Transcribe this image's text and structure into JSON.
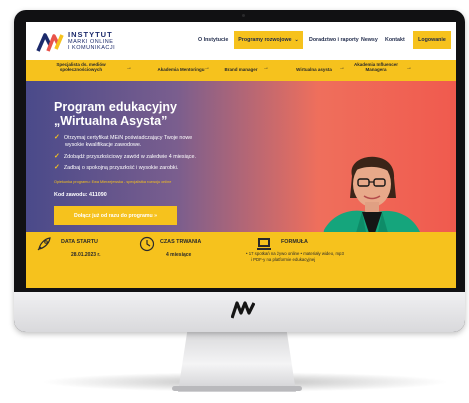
{
  "header": {
    "logo": {
      "line1": "INSTYTUT",
      "line2": "MARKI ONLINE",
      "line3": "I KOMUNIKACJI"
    },
    "nav": {
      "about": "O Instytucie",
      "development": "Programy rozwojowe",
      "consulting": "Doradztwo i raporty",
      "news": "Newsy",
      "contact": "Kontakt",
      "login": "Logowanie"
    }
  },
  "subnav": [
    "Specjalista ds. mediów społecznościowych",
    "Akademia Mentoringu",
    "Brand manager",
    "Wirtualna asysta",
    "Akademia Influencer Managera"
  ],
  "hero": {
    "title_line1": "Program edukacyjny",
    "title_line2": "„Wirtualna Asysta”",
    "bullets": [
      "Otrzymaj certyfikat MEiN poświadczający Twoje nowe",
      "wysokie kwalifikacje zawodowe.",
      "Zdobądź przyszłościowy zawód w zaledwie 4 miesiące.",
      "Zadbaj o spokojną przyszłość i wysokie zarobki."
    ],
    "authors": "Opiekunka programu: Ewa Mierzejewska - specjalistka rozwoju online",
    "code": "Kod zawodu: 411090",
    "cta": "Dołącz już od razu do programu »"
  },
  "info": {
    "start_label": "DATA STARTU",
    "start_value": "28.01.2023 r.",
    "duration_label": "CZAS TRWANIA",
    "duration_value": "4 miesiące",
    "form_label": "FORMUŁA",
    "form_text_line1": "• 17 spotkań na żywo online • materiały wideo, mp3",
    "form_text_line2": "i PDF-y na platformie edukacyjnej"
  },
  "colors": {
    "accent": "#f6c21d",
    "navy": "#1c2a6b",
    "hero_left": "#4a4a8a",
    "hero_right": "#f05a4e"
  },
  "icons": {
    "chevron": "chevron-down-icon",
    "arrow": "arrow-right-icon",
    "check": "check-icon",
    "date": "rocket-icon",
    "duration": "clock-icon",
    "form": "laptop-icon"
  }
}
